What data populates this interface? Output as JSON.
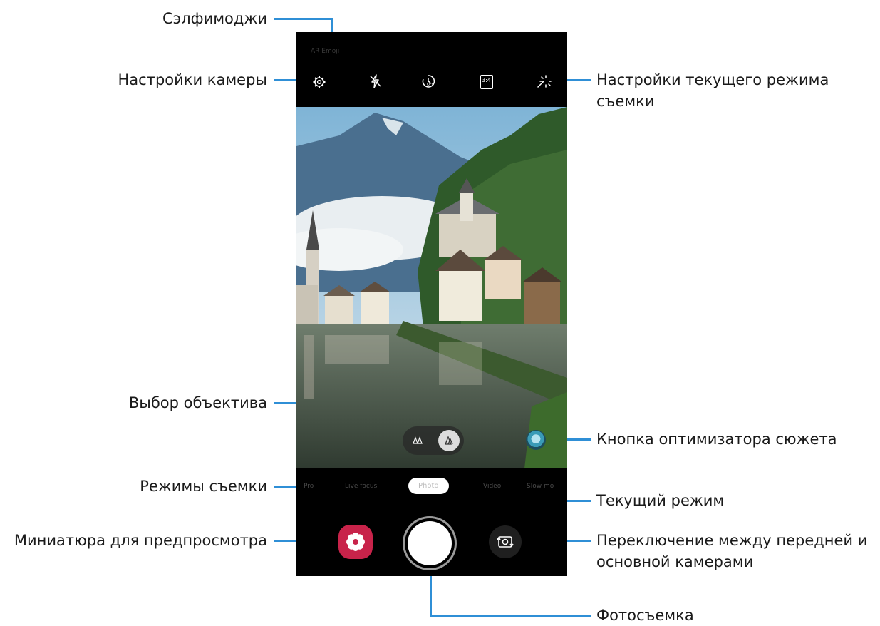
{
  "callouts": {
    "selfimoji": "Сэлфимоджи",
    "camera_settings": "Настройки камеры",
    "mode_settings_line1": "Настройки текущего режима",
    "mode_settings_line2": "съемки",
    "lens_select": "Выбор объектива",
    "scene_optimizer": "Кнопка оптимизатора сюжета",
    "shooting_modes": "Режимы съемки",
    "current_mode": "Текущий режим",
    "preview_thumbnail": "Миниатюра для предпросмотра",
    "switch_camera_line1": "Переключение между передней и",
    "switch_camera_line2": "основной камерами",
    "take_photo": "Фотосъемка"
  },
  "phone": {
    "topbar_text": "AR Emoji",
    "modes": [
      "Pro",
      "Live focus",
      "Photo",
      "Video",
      "Slow mo"
    ],
    "active_mode": "Photo",
    "ratio_label": "3:4",
    "timer_label": "OFF"
  },
  "colors": {
    "callout_line": "#2f8fd6",
    "gallery_button": "#c8234a"
  },
  "icons": {
    "flash": "flash-off-icon",
    "timer": "timer-off-icon",
    "ratio": "aspect-ratio-icon",
    "effects": "sparkle-effects-icon",
    "settings": "gear-icon",
    "wide_lens": "wide-lens-icon",
    "normal_lens": "standard-lens-icon",
    "switch_camera": "switch-camera-icon"
  }
}
